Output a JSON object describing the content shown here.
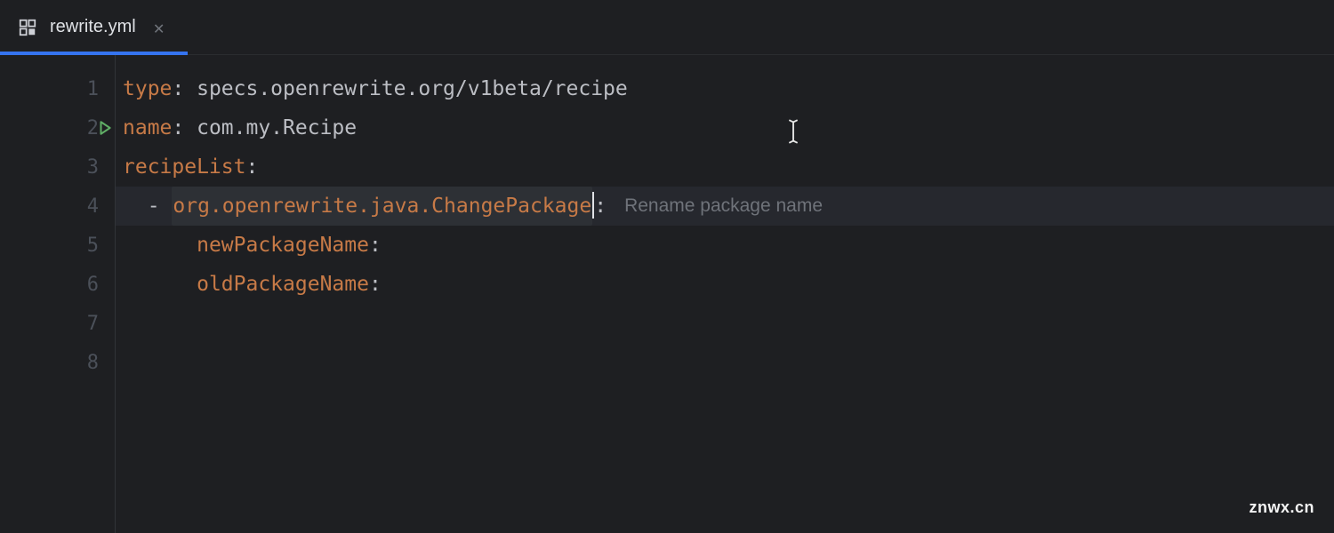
{
  "tab": {
    "filename": "rewrite.yml"
  },
  "gutter": {
    "lines": [
      "1",
      "2",
      "3",
      "4",
      "5",
      "6",
      "7",
      "8"
    ]
  },
  "code": {
    "line1_key": "type",
    "line1_value": "specs.openrewrite.org/v1beta/recipe",
    "line2_key": "name",
    "line2_value": "com.my.Recipe",
    "line3_key": "recipeList",
    "line4_value": "org.openrewrite.java.ChangePackage",
    "line4_hint": "Rename package name",
    "line5_key": "newPackageName",
    "line6_key": "oldPackageName",
    "indent2": "  ",
    "indent4_dash": "  - ",
    "indent6": "      ",
    "colon": ":",
    "colon_space": ": "
  },
  "watermark": "znwx.cn"
}
